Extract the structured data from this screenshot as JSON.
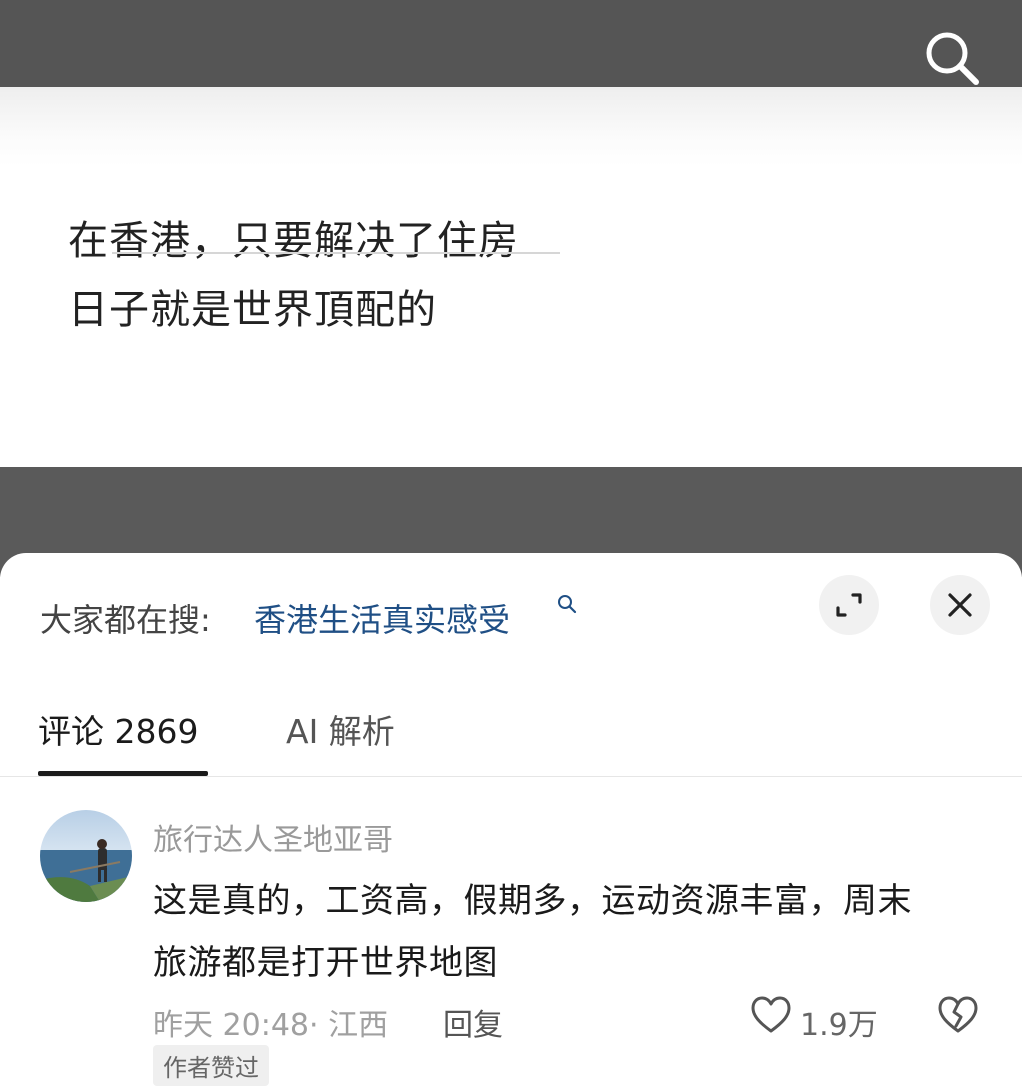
{
  "post": {
    "line1": "在香港，只要解决了住房",
    "line2": "日子就是世界頂配的"
  },
  "sheet": {
    "hot_search_prefix": "大家都在搜:",
    "hot_search_term": "香港生活真实感受",
    "tabs": [
      {
        "label": "评论 2869",
        "active": true
      },
      {
        "label": "AI 解析",
        "active": false
      }
    ]
  },
  "comment": {
    "username": "旅行达人圣地亚哥",
    "text_line1": "这是真的，工资高，假期多，运动资源丰富，周末",
    "text_line2": "旅游都是打开世界地图",
    "meta": "昨天 20:48· 江西",
    "reply_label": "回复",
    "like_count": "1.9万",
    "author_badge": "作者赞过"
  },
  "icons": {
    "search": "search-icon",
    "expand": "expand-icon",
    "close": "close-icon",
    "like": "heart-outline-icon",
    "dislike": "broken-heart-icon"
  },
  "colors": {
    "topbar": "#555555",
    "link": "#1f4f85",
    "text": "#1a1a1a",
    "muted": "#9a9a9a"
  }
}
